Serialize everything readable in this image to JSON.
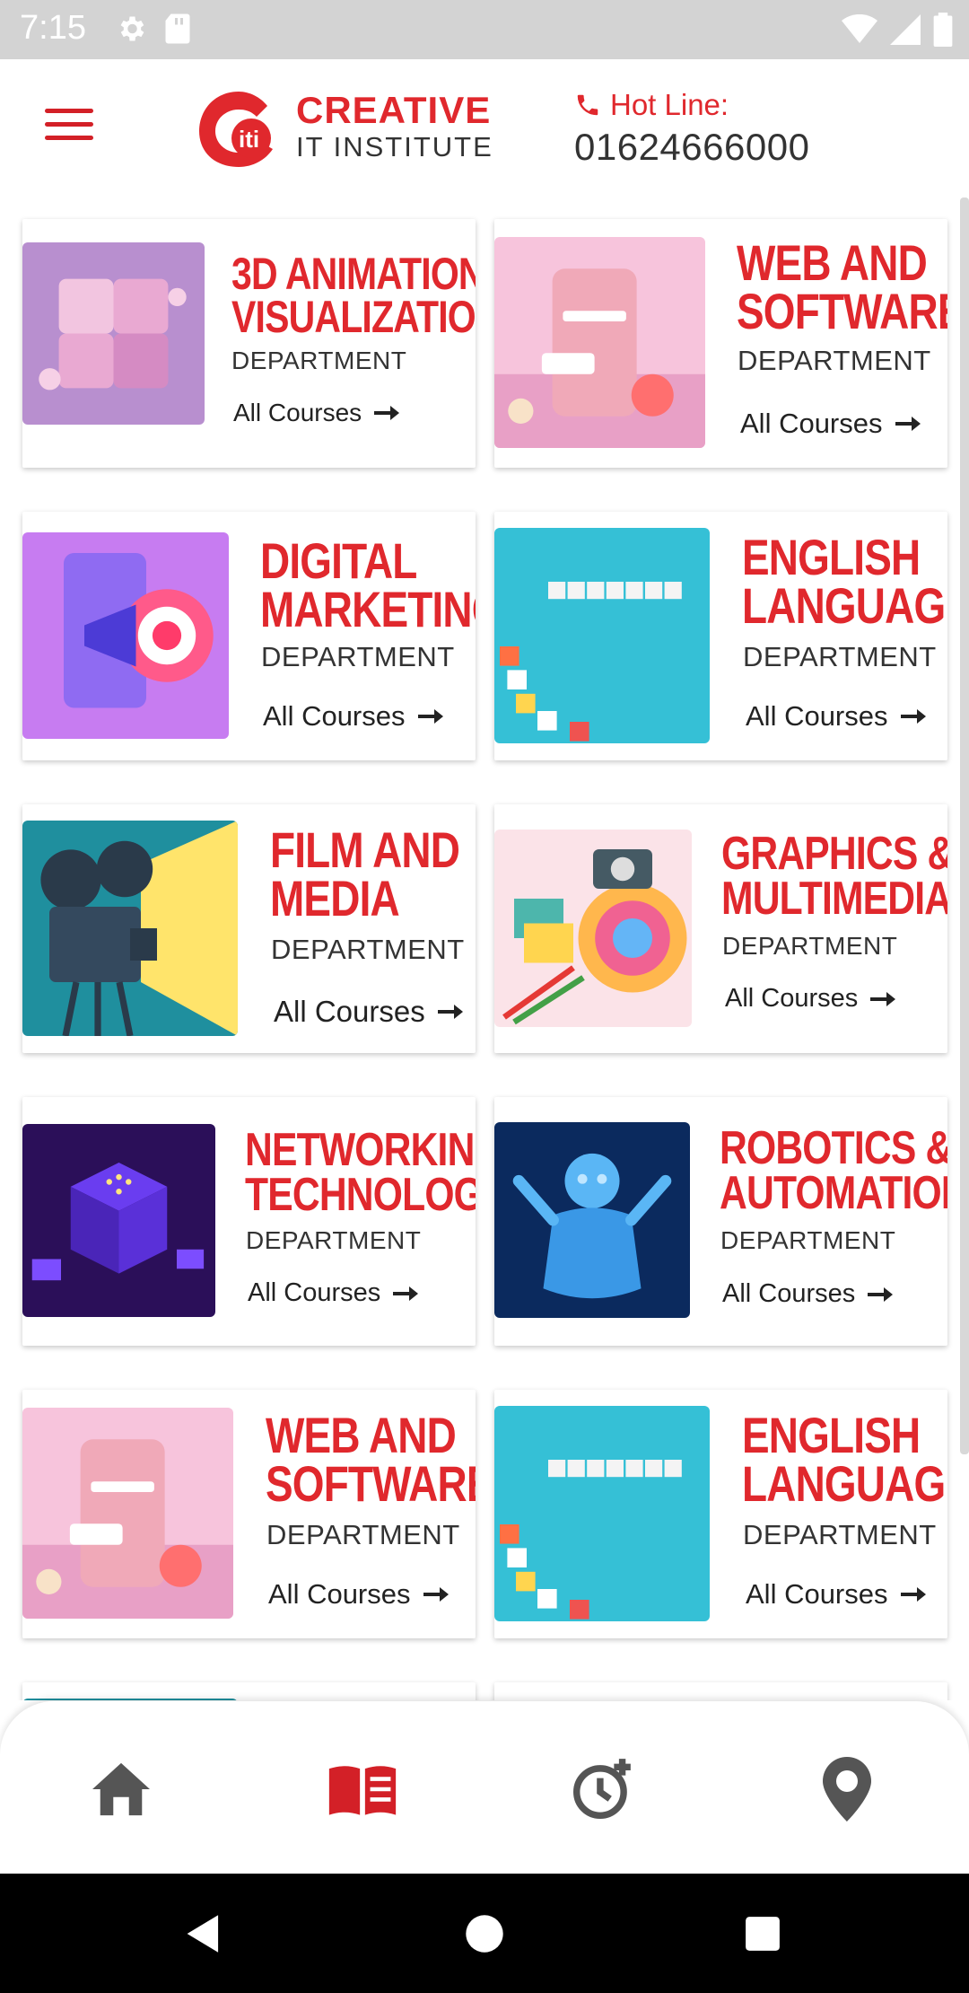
{
  "status_bar": {
    "time": "7:15"
  },
  "header": {
    "brand_name": "CREATIVE",
    "brand_sub": "IT INSTITUTE",
    "hotline_label": "Hot Line:",
    "hotline_number": "01624666000"
  },
  "cards": [
    {
      "line1": "3D ANIMATION",
      "line2": "VISUALIZATION",
      "dept": "DEPARTMENT",
      "link": "All Courses"
    },
    {
      "line1": "WEB AND",
      "line2": "SOFTWARE",
      "dept": "DEPARTMENT",
      "link": "All Courses"
    },
    {
      "line1": "DIGITAL",
      "line2": "MARKETING",
      "dept": "DEPARTMENT",
      "link": "All Courses"
    },
    {
      "line1": "ENGLISH",
      "line2": "LANGUAGE",
      "dept": "DEPARTMENT",
      "link": "All Courses"
    },
    {
      "line1": "FILM AND",
      "line2": "MEDIA",
      "dept": "DEPARTMENT",
      "link": "All Courses"
    },
    {
      "line1": "GRAPHICS &",
      "line2": "MULTIMEDIA",
      "dept": "DEPARTMENT",
      "link": "All Courses"
    },
    {
      "line1": "NETWORKING",
      "line2": "TECHNOLOGY",
      "dept": "DEPARTMENT",
      "link": "All Courses"
    },
    {
      "line1": "ROBOTICS &",
      "line2": "AUTOMATION",
      "dept": "DEPARTMENT",
      "link": "All Courses"
    },
    {
      "line1": "WEB AND",
      "line2": "SOFTWARE",
      "dept": "DEPARTMENT",
      "link": "All Courses"
    },
    {
      "line1": "ENGLISH",
      "line2": "LANGUAGE",
      "dept": "DEPARTMENT",
      "link": "All Courses"
    }
  ],
  "bottom_nav": {
    "items": [
      "home-icon",
      "courses-book-icon",
      "schedule-clock-icon",
      "location-pin-icon"
    ],
    "active": "courses-book-icon"
  },
  "colors": {
    "accent": "#e0282d",
    "nav_inactive": "#555555"
  }
}
